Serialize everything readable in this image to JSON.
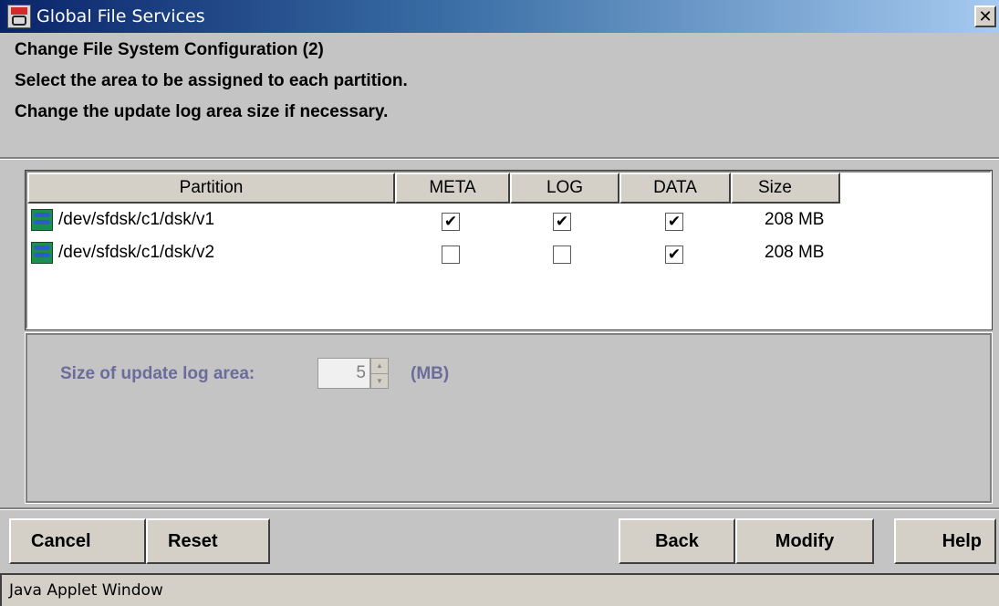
{
  "window": {
    "title": "Global File Services",
    "close_glyph": "✕"
  },
  "headings": {
    "line1": "Change File System Configuration (2)",
    "line2": "Select the area to be assigned to each partition.",
    "line3": "Change the update log area size if necessary."
  },
  "table": {
    "columns": [
      "Partition",
      "META",
      "LOG",
      "DATA",
      "Size"
    ],
    "rows": [
      {
        "partition": "/dev/sfdsk/c1/dsk/v1",
        "meta": true,
        "log": true,
        "data": true,
        "size": "208 MB"
      },
      {
        "partition": "/dev/sfdsk/c1/dsk/v2",
        "meta": false,
        "log": false,
        "data": true,
        "size": "208 MB"
      }
    ]
  },
  "log_area": {
    "label": "Size of update log area:",
    "value": "5",
    "unit": "(MB)"
  },
  "buttons": {
    "cancel": "Cancel",
    "reset": "Reset",
    "back": "Back",
    "modify": "Modify",
    "help": "Help"
  },
  "status_bar": "Java Applet Window",
  "icons": {
    "app": "applet-icon",
    "partition": "disk-icon",
    "close": "close-icon"
  },
  "colors": {
    "titlebar_start": "#0a246a",
    "titlebar_end": "#a6caf0",
    "disabled_label": "#6c6c9c",
    "window_bg": "#c4c4c4"
  }
}
